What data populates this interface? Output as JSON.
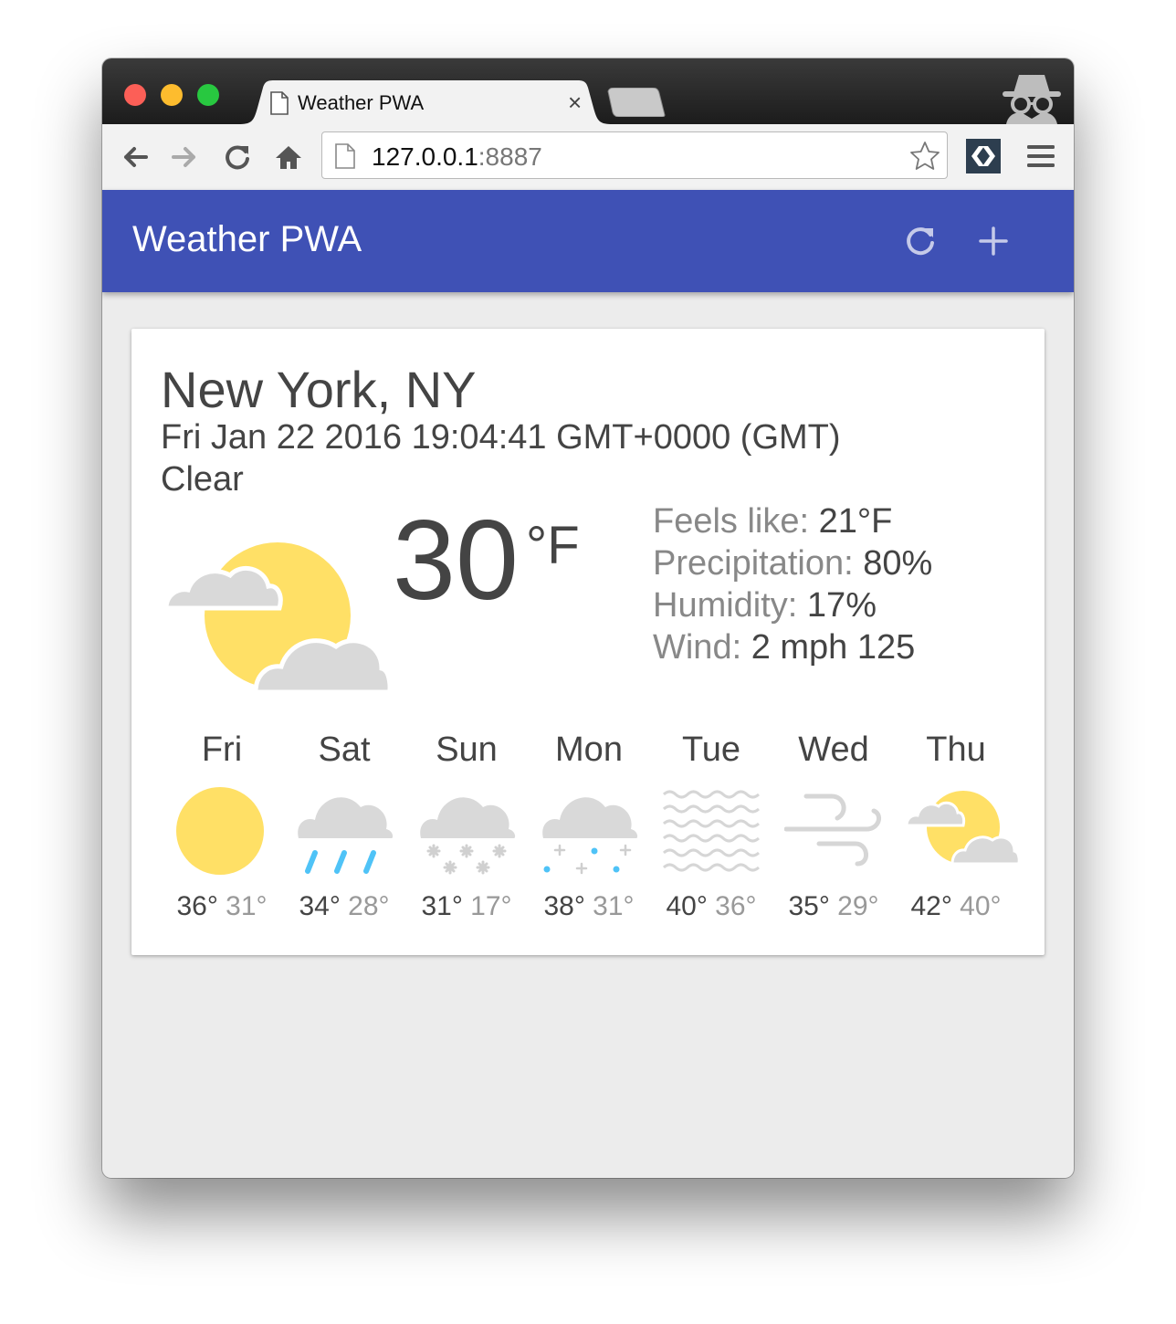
{
  "browser": {
    "tab_title": "Weather PWA",
    "tab_close": "×",
    "url_host": "127.0.0.1",
    "url_port": ":8887"
  },
  "header": {
    "title": "Weather PWA",
    "refresh_icon": "refresh-icon",
    "add_icon": "add-icon",
    "color": "#3f51b5"
  },
  "current": {
    "city": "New York, NY",
    "date": "Fri Jan 22 2016 19:04:41 GMT+0000 (GMT)",
    "description": "Clear",
    "icon": "partly-cloudy-icon",
    "temperature": "30",
    "scale": "°F",
    "feels_like_label": "Feels like: ",
    "feels_like": "21°F",
    "precip_label": "Precipitation: ",
    "precip": "80%",
    "humidity_label": "Humidity: ",
    "humidity": "17%",
    "wind_label": "Wind: ",
    "wind": "2 mph 125"
  },
  "forecast": [
    {
      "day": "Fri",
      "icon": "sun-icon",
      "high": "36°",
      "low": "31°"
    },
    {
      "day": "Sat",
      "icon": "rain-icon",
      "high": "34°",
      "low": "28°"
    },
    {
      "day": "Sun",
      "icon": "snow-icon",
      "high": "31°",
      "low": "17°"
    },
    {
      "day": "Mon",
      "icon": "sleet-icon",
      "high": "38°",
      "low": "31°"
    },
    {
      "day": "Tue",
      "icon": "fog-icon",
      "high": "40°",
      "low": "36°"
    },
    {
      "day": "Wed",
      "icon": "wind-icon",
      "high": "35°",
      "low": "29°"
    },
    {
      "day": "Thu",
      "icon": "partly-cloudy-icon",
      "high": "42°",
      "low": "40°"
    }
  ]
}
